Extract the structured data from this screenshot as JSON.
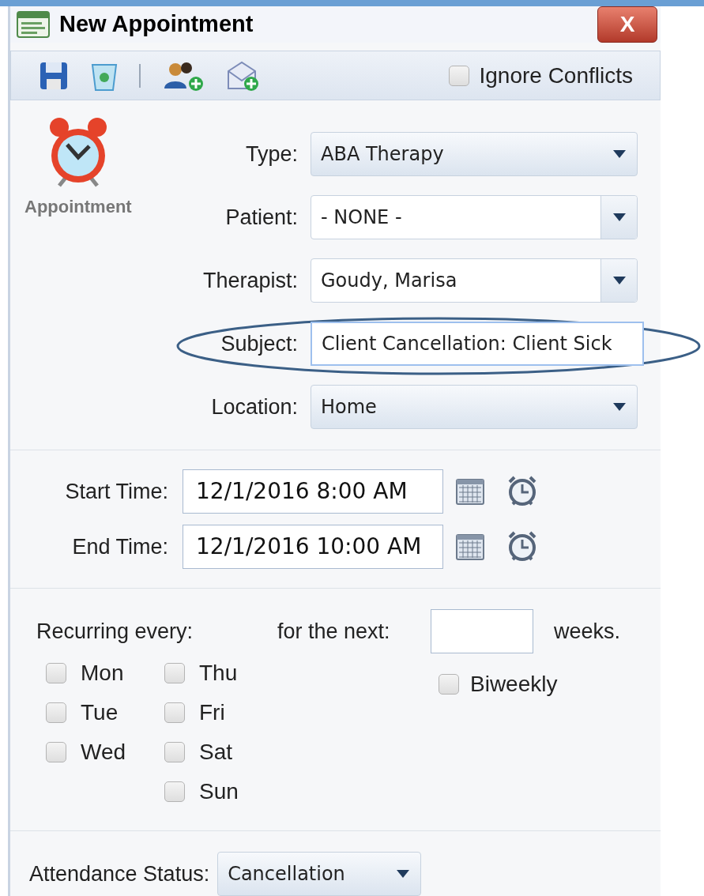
{
  "window": {
    "title": "New Appointment",
    "close": "X"
  },
  "toolbar": {
    "ignore_conflicts": {
      "label": "Ignore Conflicts",
      "checked": false
    }
  },
  "appointment_icon_label": "Appointment",
  "fields": [
    {
      "label": "Type:",
      "kind": "combo",
      "value": "ABA Therapy"
    },
    {
      "label": "Patient:",
      "kind": "split",
      "value": "- NONE -"
    },
    {
      "label": "Therapist:",
      "kind": "split",
      "value": "Goudy, Marisa"
    },
    {
      "label": "Subject:",
      "kind": "text",
      "value": "Client Cancellation: Client Sick",
      "highlighted": true
    },
    {
      "label": "Location:",
      "kind": "combo",
      "value": "Home"
    }
  ],
  "times": [
    {
      "label": "Start Time:",
      "value": "12/1/2016 8:00 AM"
    },
    {
      "label": "End Time:",
      "value": "12/1/2016 10:00 AM"
    }
  ],
  "recurrence": {
    "label": "Recurring every:",
    "next_label": "for the next:",
    "weeks_label": "weeks.",
    "days_col_1": [
      {
        "label": "Mon",
        "checked": false
      },
      {
        "label": "Tue",
        "checked": false
      },
      {
        "label": "Wed",
        "checked": false
      }
    ],
    "days_col_2": [
      {
        "label": "Thu",
        "checked": false
      },
      {
        "label": "Fri",
        "checked": false
      },
      {
        "label": "Sat",
        "checked": false
      },
      {
        "label": "Sun",
        "checked": false
      }
    ],
    "biweekly": {
      "label": "Biweekly",
      "checked": false
    }
  },
  "attendance": {
    "label": "Attendance Status:",
    "value": "Cancellation"
  }
}
